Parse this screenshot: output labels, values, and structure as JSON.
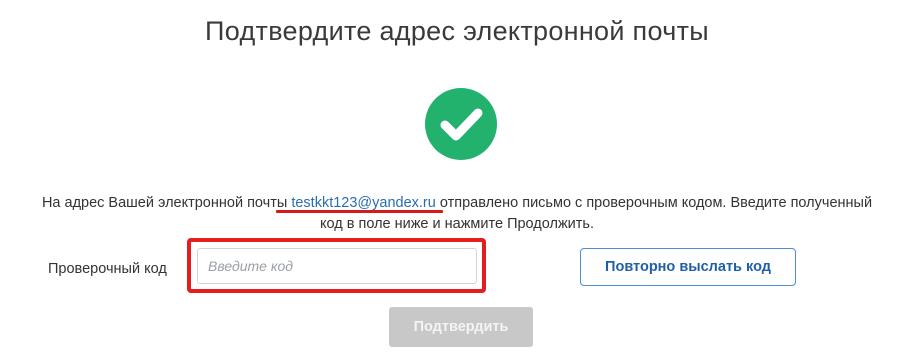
{
  "page": {
    "title": "Подтвердите адрес электронной почты"
  },
  "status": {
    "icon": "check-circle-icon",
    "color": "#23b26d"
  },
  "message": {
    "before": "На адрес Вашей электронной почты ",
    "email": "testkkt123@yandex.ru",
    "after_line1": " отправлено письмо с проверочным кодом. Введите полученный",
    "line2": "код в поле ниже и нажмите Продолжить."
  },
  "form": {
    "code_label": "Проверочный код",
    "code_value": "",
    "code_placeholder": "Введите код",
    "resend_label": "Повторно выслать код",
    "confirm_label": "Подтвердить"
  },
  "annotations": {
    "highlight_color": "#e41e1e",
    "underline_color": "#d41a1a"
  }
}
